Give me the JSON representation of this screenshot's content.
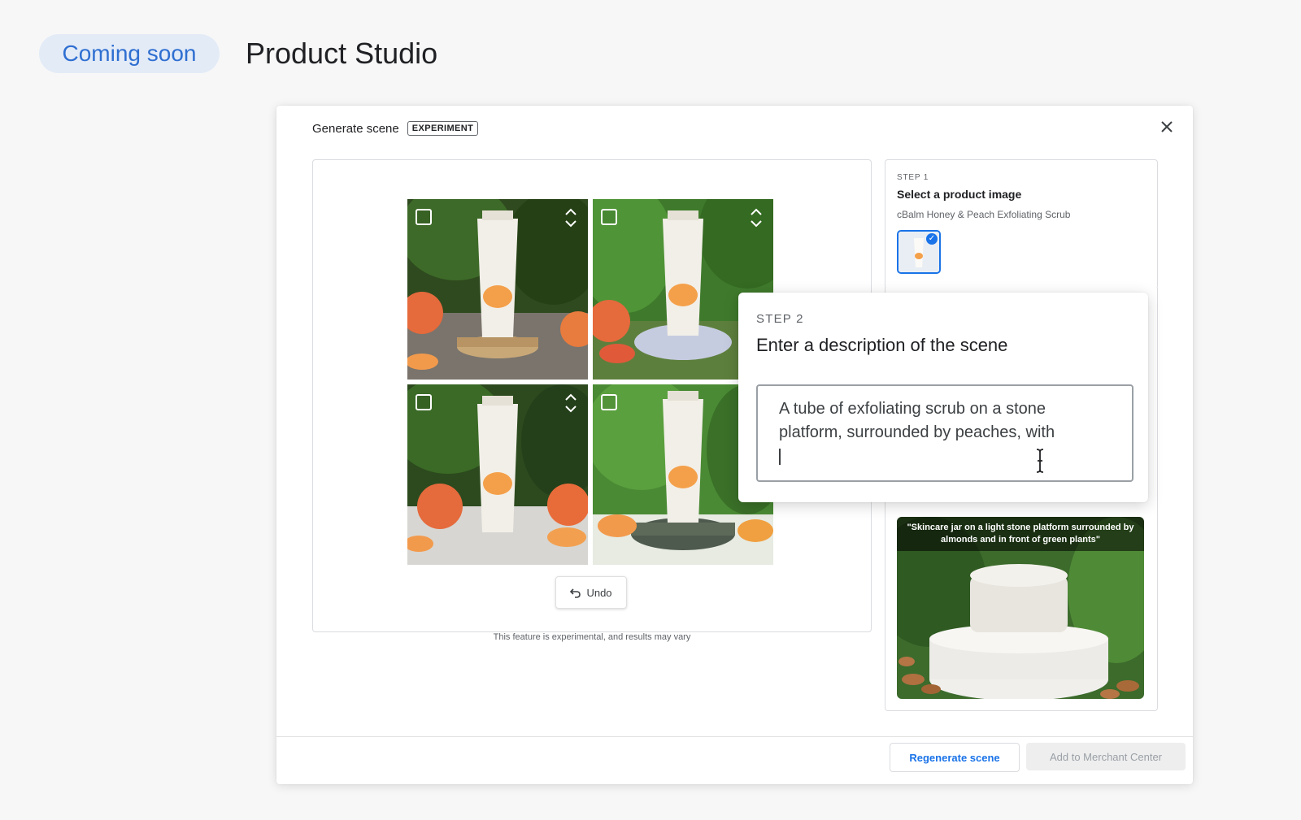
{
  "header": {
    "badge": "Coming soon",
    "title": "Product Studio"
  },
  "dialog": {
    "title": "Generate scene",
    "badge": "EXPERIMENT",
    "close_icon": "close-icon",
    "undo_label": "Undo",
    "disclaimer": "This feature is experimental, and results may vary",
    "tiles": [
      {
        "label": "generated-scene-1"
      },
      {
        "label": "generated-scene-2"
      },
      {
        "label": "generated-scene-3"
      },
      {
        "label": "generated-scene-4"
      }
    ],
    "step1": {
      "label": "STEP 1",
      "title": "Select a product image",
      "product": "cBalm Honey & Peach Exfoliating Scrub"
    },
    "step2": {
      "label": "STEP 2",
      "title": "Enter a description of the scene",
      "value": "A tube of exfoliating scrub on a stone platform, surrounded by peaches, with"
    },
    "example": {
      "caption": "\"Skincare jar on a light stone platform surrounded by almonds and in front of green plants\""
    },
    "buttons": {
      "regenerate": "Regenerate scene",
      "add": "Add to Merchant Center"
    }
  },
  "colors": {
    "accent": "#1a73e8",
    "pill_bg": "#e3ebf7",
    "pill_text": "#2f6fd1"
  }
}
